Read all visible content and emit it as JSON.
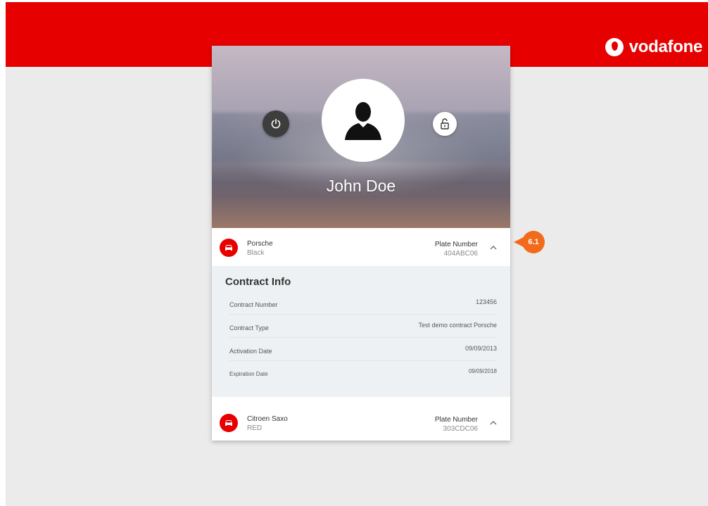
{
  "brand": {
    "name": "vodafone"
  },
  "colors": {
    "brand_red": "#e60000",
    "callout_orange": "#f26a1b",
    "contract_bg": "#eef1f3"
  },
  "profile": {
    "name": "John Doe",
    "icons": {
      "power": "power-icon",
      "lock": "lock-icon",
      "avatar": "user-silhouette-icon"
    }
  },
  "vehicles": [
    {
      "model": "Porsche",
      "color": "Black",
      "plate_label": "Plate Number",
      "plate": "404ABC06",
      "expanded": true
    },
    {
      "model": "Citroen Saxo",
      "color": "RED",
      "plate_label": "Plate Number",
      "plate": "303CDC06",
      "expanded": false
    }
  ],
  "contract": {
    "title": "Contract Info",
    "rows": [
      {
        "label": "Contract Number",
        "value": "123456"
      },
      {
        "label": "Contract Type",
        "value": "Test demo contract Porsche"
      },
      {
        "label": "Activation Date",
        "value": "09/09/2013"
      },
      {
        "label": "Expiration Date",
        "value": "09/09/2018"
      }
    ]
  },
  "callout": {
    "label": "6.1"
  }
}
